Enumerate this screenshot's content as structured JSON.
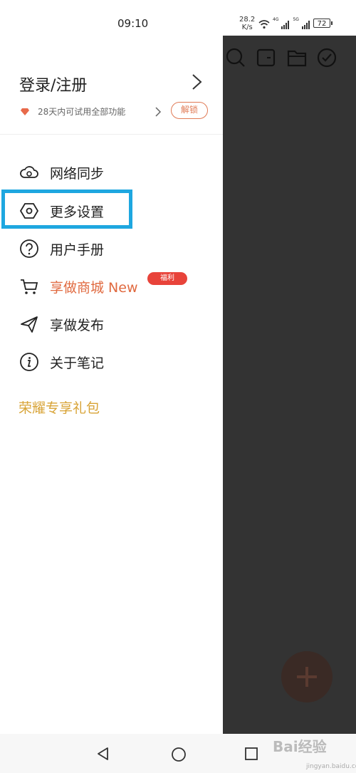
{
  "status_bar": {
    "time": "09:10",
    "speed_value": "28.2",
    "speed_unit": "K/s",
    "net_1": "4G",
    "net_2": "5G",
    "battery": "72"
  },
  "drawer": {
    "login_label": "登录/注册",
    "trial_text": "28天内可试用全部功能",
    "unlock_label": "解锁",
    "menu": [
      {
        "label": "网络同步",
        "icon": "cloud-sync-icon"
      },
      {
        "label": "更多设置",
        "icon": "hexagon-settings-icon"
      },
      {
        "label": "用户手册",
        "icon": "question-icon"
      },
      {
        "label": "享做商城 New",
        "icon": "cart-icon",
        "badge": "福利"
      },
      {
        "label": "享做发布",
        "icon": "send-icon"
      },
      {
        "label": "关于笔记",
        "icon": "info-icon"
      }
    ],
    "gift_label": "荣耀专享礼包"
  },
  "watermark": {
    "text": "Bai经验",
    "url": "jingyan.baidu.com"
  },
  "colors": {
    "accent_orange": "#e06a40",
    "highlight_blue": "#1ea7e0",
    "gift_gold": "#d8a336",
    "badge_red": "#e8433a"
  }
}
